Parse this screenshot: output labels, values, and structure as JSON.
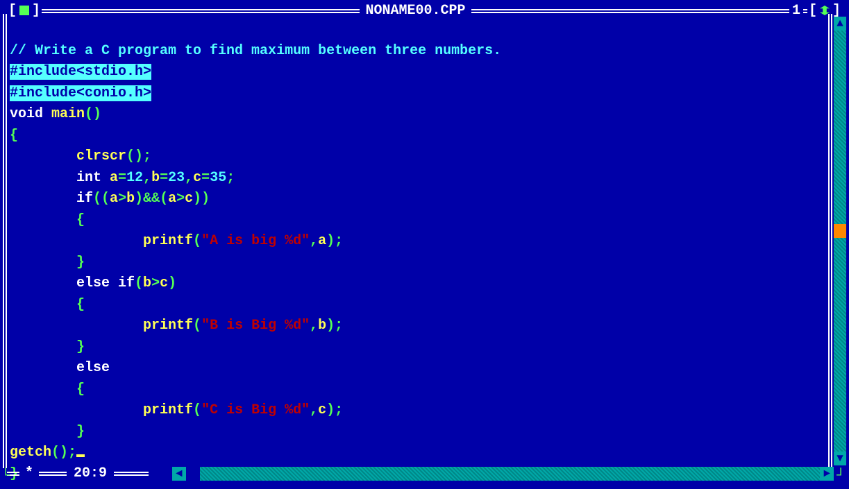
{
  "title": "NONAME00.CPP",
  "window_number": "1",
  "close_marker_left": "[",
  "close_marker_right": "]",
  "resize_marker_left": "[",
  "resize_marker_right": "]",
  "status": {
    "modified_marker": "*",
    "cursor_position": "20:9"
  },
  "code": {
    "l1": "// Write a C program to find maximum between three numbers.",
    "l2": "#include<stdio.h>",
    "l3": "#include<conio.h>",
    "l4a": "void",
    "l4b": " main",
    "l4c": "()",
    "l5": "{",
    "l6a": "        clrscr",
    "l6b": "();",
    "l7a": "        int",
    "l7b": " a",
    "l7c": "=",
    "l7d": "12",
    "l7e": ",",
    "l7f": "b",
    "l7g": "=",
    "l7h": "23",
    "l7i": ",",
    "l7j": "c",
    "l7k": "=",
    "l7l": "35",
    "l7m": ";",
    "l8a": "        if",
    "l8b": "((",
    "l8c": "a",
    "l8d": ">",
    "l8e": "b",
    "l8f": ")&&(",
    "l8g": "a",
    "l8h": ">",
    "l8i": "c",
    "l8j": "))",
    "l9": "        {",
    "l10a": "                printf",
    "l10b": "(",
    "l10c": "\"A is big %d\"",
    "l10d": ",",
    "l10e": "a",
    "l10f": ");",
    "l11": "        }",
    "l12a": "        else if",
    "l12b": "(",
    "l12c": "b",
    "l12d": ">",
    "l12e": "c",
    "l12f": ")",
    "l13": "        {",
    "l14a": "                printf",
    "l14b": "(",
    "l14c": "\"B is Big %d\"",
    "l14d": ",",
    "l14e": "b",
    "l14f": ");",
    "l15": "        }",
    "l16a": "        else",
    "l17": "        {",
    "l18a": "                printf",
    "l18b": "(",
    "l18c": "\"C is Big %d\"",
    "l18d": ",",
    "l18e": "c",
    "l18f": ");",
    "l19": "        }",
    "l20a": "getch",
    "l20b": "();",
    "l21": "}"
  }
}
